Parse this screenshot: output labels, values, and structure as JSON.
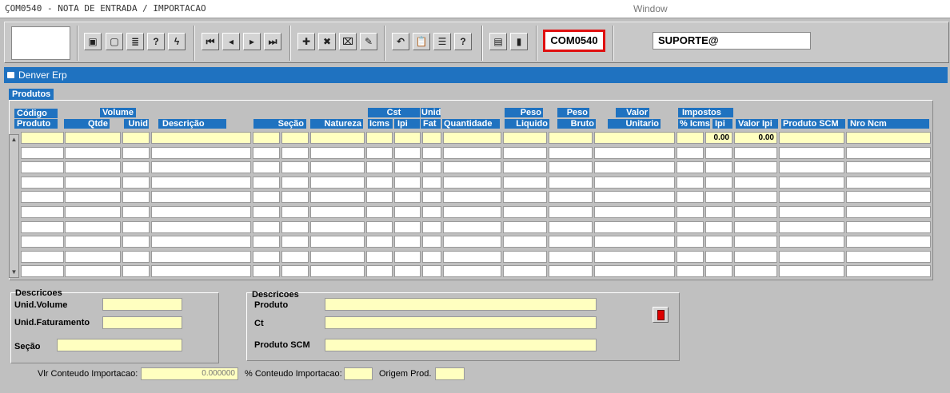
{
  "window_title": "ÇOM0540 - NOTA DE ENTRADA / IMPORTACAO",
  "window_menu": "Window",
  "toolbar": {
    "form_code": "COM0540",
    "user": "SUPORTE@",
    "buttons": [
      {
        "name": "save-button",
        "glyph": "▣"
      },
      {
        "name": "screen-button",
        "glyph": "▢"
      },
      {
        "name": "print-button",
        "glyph": "≣"
      },
      {
        "name": "query-help-button",
        "glyph": "?"
      },
      {
        "name": "execute-query-button",
        "glyph": "ϟ"
      },
      {
        "name": "first-record-button",
        "glyph": "⏮"
      },
      {
        "name": "previous-record-button",
        "glyph": "◂"
      },
      {
        "name": "next-record-button",
        "glyph": "▸"
      },
      {
        "name": "last-record-button",
        "glyph": "⏭"
      },
      {
        "name": "insert-record-button",
        "glyph": "✚"
      },
      {
        "name": "delete-record-button",
        "glyph": "✖"
      },
      {
        "name": "clear-record-button",
        "glyph": "⌧"
      },
      {
        "name": "edit-record-button",
        "glyph": "✎"
      },
      {
        "name": "undo-button",
        "glyph": "↶"
      },
      {
        "name": "clipboard-button",
        "glyph": "📋"
      },
      {
        "name": "list-values-button",
        "glyph": "☰"
      },
      {
        "name": "help-button",
        "glyph": "?"
      },
      {
        "name": "menu-button",
        "glyph": "▤"
      },
      {
        "name": "exit-button",
        "glyph": "▮"
      }
    ]
  },
  "main_window_title": "Denver Erp",
  "produtos": {
    "section_title": "Produtos",
    "headers": {
      "codigo": "Código",
      "produto": "Produto",
      "volume": "Volume",
      "qtde": "Qtde",
      "unid": "Unid",
      "descricao": "Descrição",
      "secao": "Seção",
      "natureza": "Natureza",
      "cst": "Cst",
      "icms": "Icms",
      "ipi": "Ipi",
      "unid_fat_1": "Unid",
      "unid_fat_2": "Fat",
      "quantidade": "Quantidade",
      "peso": "Peso",
      "liquido": "Liquido",
      "peso2": "Peso",
      "bruto": "Bruto",
      "valor": "Valor",
      "unitario": "Unitario",
      "impostos": "Impostos",
      "pct_icms": "% Icms",
      "ipi2": "Ipi",
      "valor_ipi": "Valor Ipi",
      "produto_scm": "Produto SCM",
      "nro_ncm": "Nro Ncm"
    },
    "first_row": {
      "ipi": "0.00",
      "valor_ipi": "0.00"
    },
    "row_count": 10
  },
  "descricoes_left": {
    "title": "Descricoes",
    "unid_volume": "Unid.Volume",
    "unid_faturamento": "Unid.Faturamento",
    "secao": "Seção"
  },
  "descricoes_right": {
    "title": "Descricoes",
    "produto": "Produto",
    "ct": "Ct",
    "produto_scm": "Produto SCM"
  },
  "footer": {
    "vlr_conteudo_label": "Vlr Conteudo Importacao:",
    "vlr_conteudo_value": "0.000000",
    "pct_conteudo_label": "% Conteudo Importacao:",
    "origem_label": "Origem Prod."
  }
}
